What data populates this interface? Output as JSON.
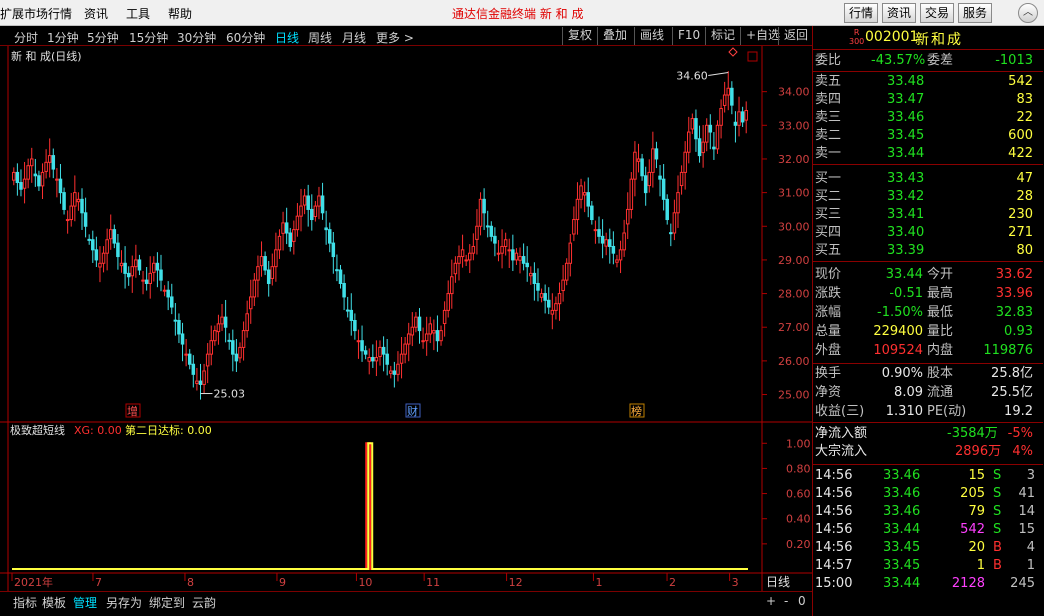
{
  "menubar": {
    "items": [
      "扩展市场行情",
      "资讯",
      "工具",
      "帮助"
    ],
    "app_title": "通达信金融终端   新 和 成",
    "buttons": [
      "行情",
      "资讯",
      "交易",
      "服务"
    ]
  },
  "toolbar": {
    "periods": [
      "分时",
      "1分钟",
      "5分钟",
      "15分钟",
      "30分钟",
      "60分钟",
      "日线",
      "周线",
      "月线",
      "更多 >"
    ],
    "active": "日线",
    "right_buttons": [
      "复权",
      "叠加",
      "画线",
      "F10",
      "标记",
      "+自选",
      "返回"
    ]
  },
  "main_chart": {
    "title": "新 和 成(日线)",
    "y_ticks": [
      "34.00",
      "33.00",
      "32.00",
      "31.00",
      "30.00",
      "29.00",
      "28.00",
      "27.00",
      "26.00",
      "25.00"
    ],
    "high_label": "34.60",
    "low_label": "25.03",
    "markers": [
      "增",
      "财",
      "榜"
    ],
    "colors": {
      "up": "#ff3030",
      "down": "#40e0e8",
      "axis": "#b00000"
    }
  },
  "indicator": {
    "name": "极致超短线",
    "xg_label": "XG: 0.00",
    "second_label": "第二日达标: 0.00",
    "y_ticks": [
      "1.00",
      "0.80",
      "0.60",
      "0.40",
      "0.20"
    ],
    "x_labels": [
      "2021年",
      "7",
      "8",
      "9",
      "10",
      "11",
      "12",
      "1",
      "2",
      "3"
    ],
    "period": "日线"
  },
  "chart_data": {
    "type": "candlestick",
    "title": "新 和 成(日线)",
    "ylim": [
      24.6,
      35.0
    ],
    "annotations": {
      "high": 34.6,
      "low": 25.03
    },
    "months": [
      "2021年",
      "7",
      "8",
      "9",
      "10",
      "11",
      "12",
      "1",
      "2",
      "3"
    ],
    "closes": [
      31.6,
      31.3,
      31.1,
      31.4,
      31.8,
      32.0,
      31.5,
      31.2,
      31.6,
      31.9,
      32.1,
      31.7,
      31.4,
      31.0,
      30.5,
      30.2,
      30.6,
      31.0,
      30.8,
      30.4,
      30.0,
      29.6,
      29.3,
      29.0,
      28.9,
      29.2,
      29.6,
      29.9,
      29.5,
      29.1,
      28.9,
      28.6,
      28.5,
      28.8,
      29.0,
      28.7,
      28.4,
      28.3,
      28.6,
      28.9,
      28.7,
      28.4,
      28.1,
      27.9,
      27.6,
      27.2,
      26.8,
      26.5,
      26.2,
      25.9,
      25.6,
      25.4,
      25.3,
      25.7,
      26.2,
      26.6,
      26.9,
      27.1,
      27.3,
      27.0,
      26.6,
      26.2,
      26.0,
      26.4,
      26.9,
      27.4,
      27.9,
      28.4,
      28.8,
      29.1,
      28.7,
      28.3,
      28.8,
      29.3,
      29.7,
      30.1,
      29.8,
      29.4,
      29.9,
      30.3,
      30.6,
      30.9,
      30.5,
      30.2,
      30.6,
      30.9,
      30.4,
      29.9,
      29.5,
      29.1,
      28.7,
      28.3,
      27.9,
      27.5,
      27.2,
      26.9,
      26.6,
      26.3,
      26.2,
      26.1,
      26.0,
      26.1,
      26.4,
      26.2,
      25.9,
      25.7,
      25.6,
      25.9,
      26.2,
      26.5,
      26.8,
      27.0,
      27.3,
      26.9,
      26.6,
      26.8,
      27.1,
      26.9,
      26.6,
      26.9,
      27.5,
      28.0,
      28.5,
      28.9,
      29.1,
      29.3,
      29.0,
      29.2,
      29.4,
      30.0,
      30.8,
      30.4,
      30.0,
      29.7,
      29.5,
      29.2,
      29.4,
      29.6,
      29.3,
      29.0,
      29.2,
      29.1,
      28.9,
      28.8,
      28.6,
      28.3,
      28.1,
      28.0,
      27.8,
      27.6,
      27.5,
      27.7,
      28.0,
      28.4,
      28.9,
      29.5,
      30.2,
      30.8,
      31.2,
      31.0,
      30.6,
      30.2,
      29.9,
      29.7,
      29.5,
      29.6,
      29.4,
      29.2,
      29.0,
      29.3,
      29.8,
      30.5,
      31.4,
      32.2,
      32.0,
      31.5,
      31.0,
      31.6,
      32.3,
      32.0,
      31.4,
      30.8,
      30.2,
      29.8,
      30.4,
      31.0,
      31.6,
      32.2,
      32.8,
      33.2,
      32.6,
      32.1,
      32.5,
      33.0,
      32.8,
      32.3,
      33.0,
      33.5,
      33.9,
      34.1,
      33.6,
      33.0,
      33.4,
      33.1,
      33.44
    ],
    "indicator_series": {
      "XG": {
        "color": "#ff2020",
        "spike_index": 99,
        "value": 1.0
      },
      "第二日达标": {
        "color": "#ffff40",
        "spike_index": 99,
        "value": 1.0
      }
    }
  },
  "quote": {
    "badge_top": "R",
    "badge_bottom": "300",
    "code": "002001",
    "name": "新和成",
    "weibi_label": "委比",
    "weibi": "-43.57%",
    "weicha_label": "委差",
    "weicha": "-1013",
    "asks": [
      {
        "label": "卖五",
        "price": "33.48",
        "vol": "542"
      },
      {
        "label": "卖四",
        "price": "33.47",
        "vol": "83"
      },
      {
        "label": "卖三",
        "price": "33.46",
        "vol": "22"
      },
      {
        "label": "卖二",
        "price": "33.45",
        "vol": "600"
      },
      {
        "label": "卖一",
        "price": "33.44",
        "vol": "422"
      }
    ],
    "bids": [
      {
        "label": "买一",
        "price": "33.43",
        "vol": "47"
      },
      {
        "label": "买二",
        "price": "33.42",
        "vol": "28"
      },
      {
        "label": "买三",
        "price": "33.41",
        "vol": "230"
      },
      {
        "label": "买四",
        "price": "33.40",
        "vol": "271"
      },
      {
        "label": "买五",
        "price": "33.39",
        "vol": "80"
      }
    ],
    "stats": [
      {
        "l1": "现价",
        "v1": "33.44",
        "c1": "down",
        "l2": "今开",
        "v2": "33.62",
        "c2": "up"
      },
      {
        "l1": "涨跌",
        "v1": "-0.51",
        "c1": "down",
        "l2": "最高",
        "v2": "33.96",
        "c2": "up"
      },
      {
        "l1": "涨幅",
        "v1": "-1.50%",
        "c1": "down",
        "l2": "最低",
        "v2": "32.83",
        "c2": "down"
      },
      {
        "l1": "总量",
        "v1": "229400",
        "c1": "yel",
        "l2": "量比",
        "v2": "0.93",
        "c2": "down"
      },
      {
        "l1": "外盘",
        "v1": "109524",
        "c1": "up",
        "l2": "内盘",
        "v2": "119876",
        "c2": "down"
      }
    ],
    "fundamentals": [
      {
        "l1": "换手",
        "v1": "0.90%",
        "l2": "股本",
        "v2": "25.8亿"
      },
      {
        "l1": "净资",
        "v1": "8.09",
        "l2": "流通",
        "v2": "25.5亿"
      },
      {
        "l1": "收益(三)",
        "v1": "1.310",
        "l2": "PE(动)",
        "v2": "19.2"
      }
    ],
    "netflow_label": "净流入额",
    "netflow": "-3584万",
    "netflow_pct": "-5%",
    "block_label": "大宗流入",
    "block": "2896万",
    "block_pct": "4%",
    "ticks": [
      {
        "time": "14:56",
        "price": "33.46",
        "vol": "15",
        "vc": "yel",
        "side": "S",
        "n": "3"
      },
      {
        "time": "14:56",
        "price": "33.46",
        "vol": "205",
        "vc": "yel",
        "side": "S",
        "n": "41"
      },
      {
        "time": "14:56",
        "price": "33.46",
        "vol": "79",
        "vc": "yel",
        "side": "S",
        "n": "14"
      },
      {
        "time": "14:56",
        "price": "33.44",
        "vol": "542",
        "vc": "mag",
        "side": "S",
        "n": "15"
      },
      {
        "time": "14:56",
        "price": "33.45",
        "vol": "20",
        "vc": "yel",
        "side": "B",
        "n": "4"
      },
      {
        "time": "14:57",
        "price": "33.45",
        "vol": "1",
        "vc": "yel",
        "side": "B",
        "n": "1"
      },
      {
        "time": "15:00",
        "price": "33.44",
        "vol": "2128",
        "vc": "mag",
        "side": "",
        "n": "245"
      }
    ]
  },
  "bottom_tabs": [
    "指标",
    "模板",
    "管理",
    "另存为",
    "绑定到",
    "云韵"
  ],
  "bottom_active": "管理",
  "bottom_controls": [
    "+",
    "-",
    "0"
  ]
}
